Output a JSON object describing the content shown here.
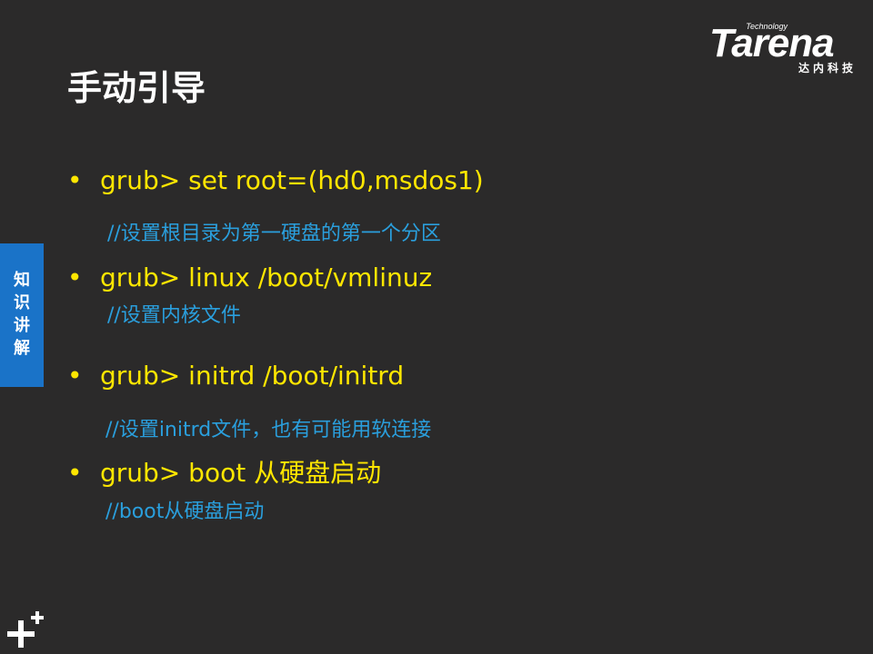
{
  "slide": {
    "title": "手动引导",
    "side_tab": "知识讲解",
    "logo": {
      "tech": "Technology",
      "brand": "Tarena",
      "cn": "达内科技"
    },
    "items": [
      {
        "bullet": "•",
        "text": "grub>  set root=(hd0,msdos1)",
        "comment": "//设置根目录为第一硬盘的第一个分区"
      },
      {
        "bullet": "•",
        "text": "grub>  linux /boot/vmlinuz",
        "comment": "//设置内核文件"
      },
      {
        "bullet": "•",
        "text": "grub>  initrd /boot/initrd",
        "comment": "//设置initrd文件，也有可能用软连接"
      },
      {
        "bullet": "•",
        "text": "grub>  boot 从硬盘启动",
        "comment": "//boot从硬盘启动"
      }
    ]
  },
  "colors": {
    "background": "#2b2a2a",
    "title": "#ffffff",
    "command": "#ffe600",
    "comment": "#2a9fdd",
    "side_tab": "#1a73c8"
  },
  "icons": {
    "corner": "plus-cluster-icon"
  }
}
